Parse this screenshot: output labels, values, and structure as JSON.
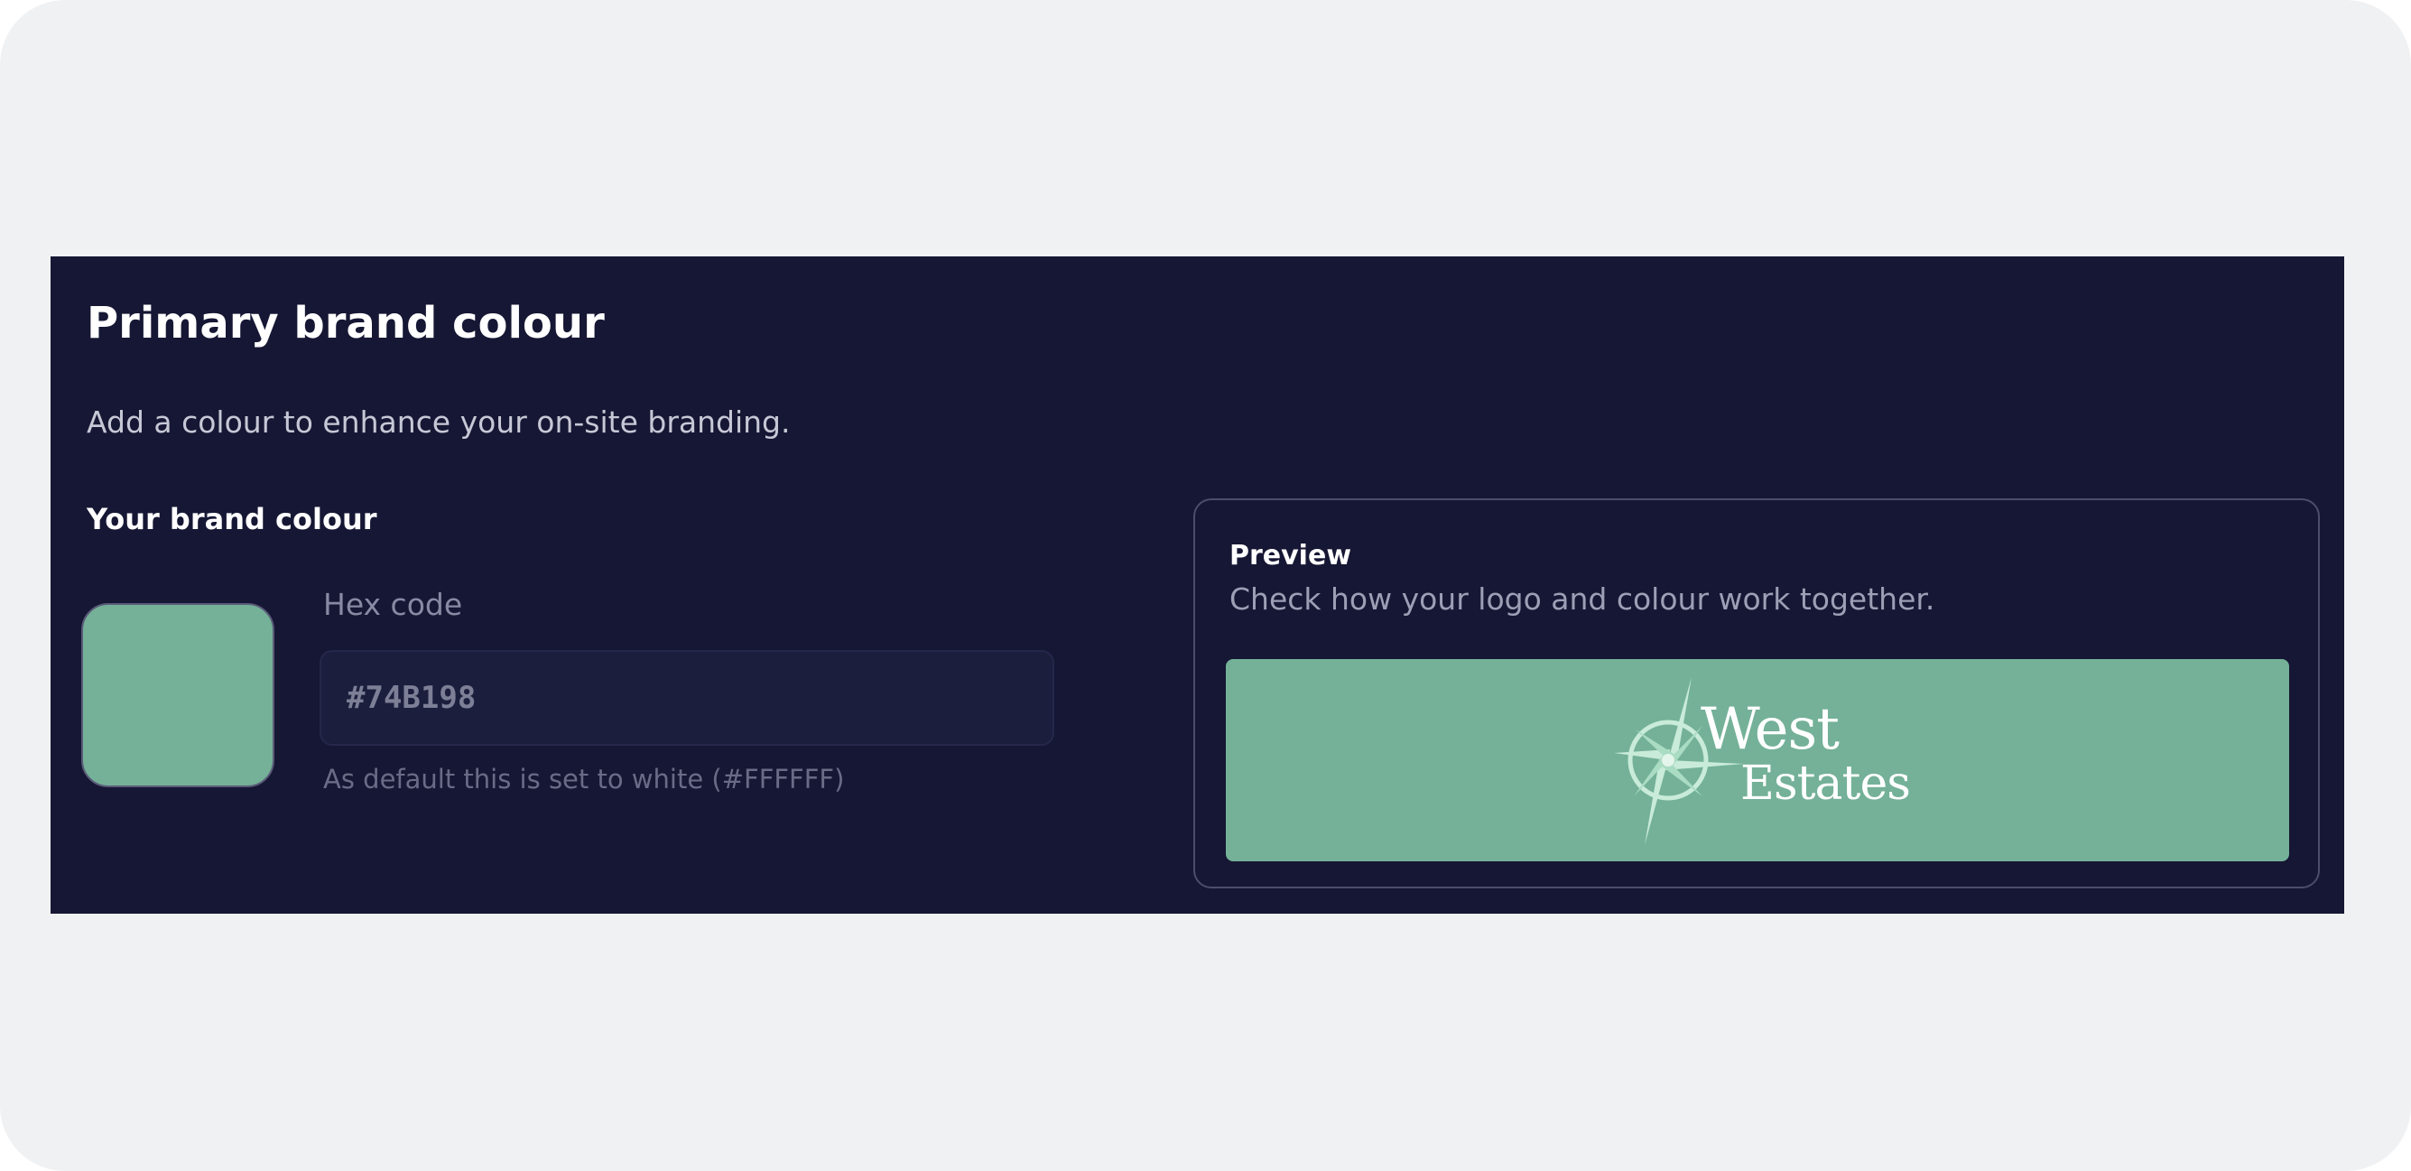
{
  "colors": {
    "brand": "#74B198",
    "panel_bg": "#161734"
  },
  "header": {
    "title": "Primary brand colour",
    "subtitle": "Add a colour to enhance your on-site branding."
  },
  "brand_colour": {
    "section_label": "Your brand colour",
    "hex_label": "Hex code",
    "hex_value": "#74B198",
    "hint": "As default this is set to white (#FFFFFF)"
  },
  "preview": {
    "title": "Preview",
    "description": "Check how your logo and colour work together.",
    "logo_icon": "compass-star-icon",
    "logo_line_1": "West",
    "logo_line_2": "Estates"
  }
}
